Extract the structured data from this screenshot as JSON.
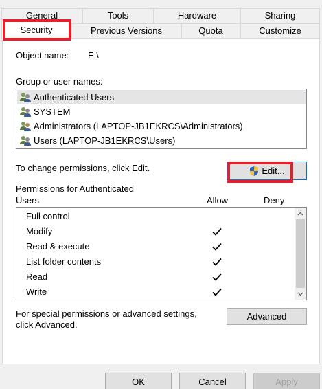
{
  "tabs_row1": [
    "General",
    "Tools",
    "Hardware",
    "Sharing"
  ],
  "tabs_row2": [
    "Security",
    "Previous Versions",
    "Quota",
    "Customize"
  ],
  "object": {
    "label": "Object name:",
    "value": "E:\\"
  },
  "groups": {
    "label": "Group or user names:",
    "items": [
      "Authenticated Users",
      "SYSTEM",
      "Administrators (LAPTOP-JB1EKRCS\\Administrators)",
      "Users (LAPTOP-JB1EKRCS\\Users)"
    ],
    "selected_index": 0
  },
  "change_text": "To change permissions, click Edit.",
  "edit_label": "Edit...",
  "permissions": {
    "header_line1": "Permissions for Authenticated",
    "header_line2": "Users",
    "allow_label": "Allow",
    "deny_label": "Deny",
    "rows": [
      {
        "name": "Full control",
        "allow": false,
        "deny": false
      },
      {
        "name": "Modify",
        "allow": true,
        "deny": false
      },
      {
        "name": "Read & execute",
        "allow": true,
        "deny": false
      },
      {
        "name": "List folder contents",
        "allow": true,
        "deny": false
      },
      {
        "name": "Read",
        "allow": true,
        "deny": false
      },
      {
        "name": "Write",
        "allow": true,
        "deny": false
      }
    ]
  },
  "special": {
    "line1": "For special permissions or advanced settings,",
    "line2": "click Advanced.",
    "advanced_label": "Advanced"
  },
  "footer": {
    "ok": "OK",
    "cancel": "Cancel",
    "apply": "Apply"
  },
  "colors": {
    "highlight": "#e3202c",
    "selection": "#e5e5e5",
    "focus": "#0078d7"
  }
}
